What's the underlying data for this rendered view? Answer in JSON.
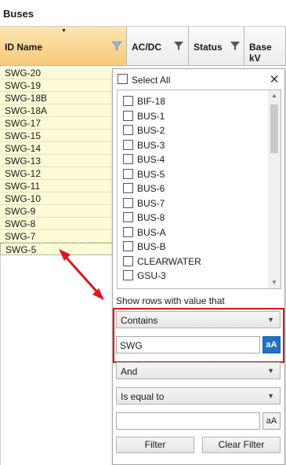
{
  "title": "Buses",
  "columns": [
    {
      "label": "ID Name"
    },
    {
      "label": "AC/DC"
    },
    {
      "label": "Status"
    },
    {
      "label": "Base kV"
    }
  ],
  "rows": [
    "SWG-20",
    "SWG-19",
    "SWG-18B",
    "SWG-18A",
    "SWG-17",
    "SWG-15",
    "SWG-14",
    "SWG-13",
    "SWG-12",
    "SWG-11",
    "SWG-10",
    "SWG-9",
    "SWG-8",
    "SWG-7",
    "SWG-5"
  ],
  "filter_popup": {
    "select_all_label": "Select All",
    "list_items": [
      "BIF-18",
      "BUS-1",
      "BUS-2",
      "BUS-3",
      "BUS-4",
      "BUS-5",
      "BUS-6",
      "BUS-7",
      "BUS-8",
      "BUS-A",
      "BUS-B",
      "CLEARWATER",
      "GSU-3"
    ],
    "show_rows_label": "Show rows with value that",
    "condition1": "Contains",
    "value1": "SWG",
    "match_case_label": "aA",
    "logic_operator": "And",
    "condition2": "Is equal to",
    "value2": "",
    "filter_button": "Filter",
    "clear_filter_button": "Clear Filter"
  },
  "colors": {
    "row_highlight": "#fdfad7",
    "active_header": "#f6c97a",
    "accent_blue": "#1e72c8",
    "annotation_red": "#e0141c"
  }
}
